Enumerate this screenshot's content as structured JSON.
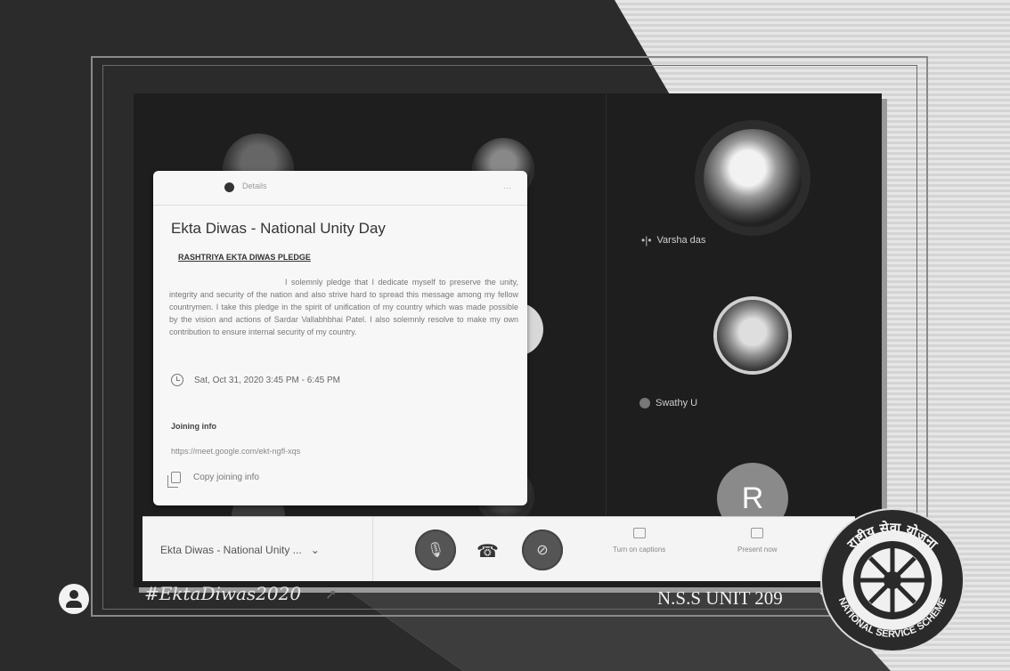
{
  "meet": {
    "participants": [
      {
        "name": "Varsha das"
      },
      {
        "name": "Swathy U"
      },
      {
        "initial": "R"
      }
    ]
  },
  "event_popup": {
    "tab_label": "Details",
    "tab_right": "…",
    "title": "Ekta Diwas - National Unity Day",
    "pledge_heading": "RASHTRIYA EKTA DIWAS PLEDGE",
    "pledge_text": "I solemnly pledge that I dedicate myself to preserve the unity, integrity and security of the nation and also strive hard to spread this message among my fellow countrymen. I take this pledge in the spirit of unification of my country which was made possible by the vision and actions of Sardar Vallabhbhai Patel. I also solemnly resolve to make my own contribution to ensure internal security of my country.",
    "time": "Sat, Oct 31, 2020 3:45 PM - 6:45 PM",
    "joining_heading": "Joining info",
    "joining_link": "https://meet.google.com/ekt-ngfl-xqs",
    "copy_label": "Copy joining info"
  },
  "bottom_bar": {
    "meeting_name": "Ekta Diwas - National Unity ...",
    "chevron": "⌄",
    "mic_icon": "🎙",
    "hangup_icon": "☎",
    "camera_icon": "⊘",
    "captions_label": "Turn on captions",
    "present_label": "Present now"
  },
  "overlay": {
    "hashtag": "#EktaDiwas2020",
    "unit": "N.S.S UNIT 209",
    "logo_top_text": "राष्ट्रीय सेवा योजना",
    "logo_bottom_text": "NATIONAL SERVICE SCHEME"
  }
}
